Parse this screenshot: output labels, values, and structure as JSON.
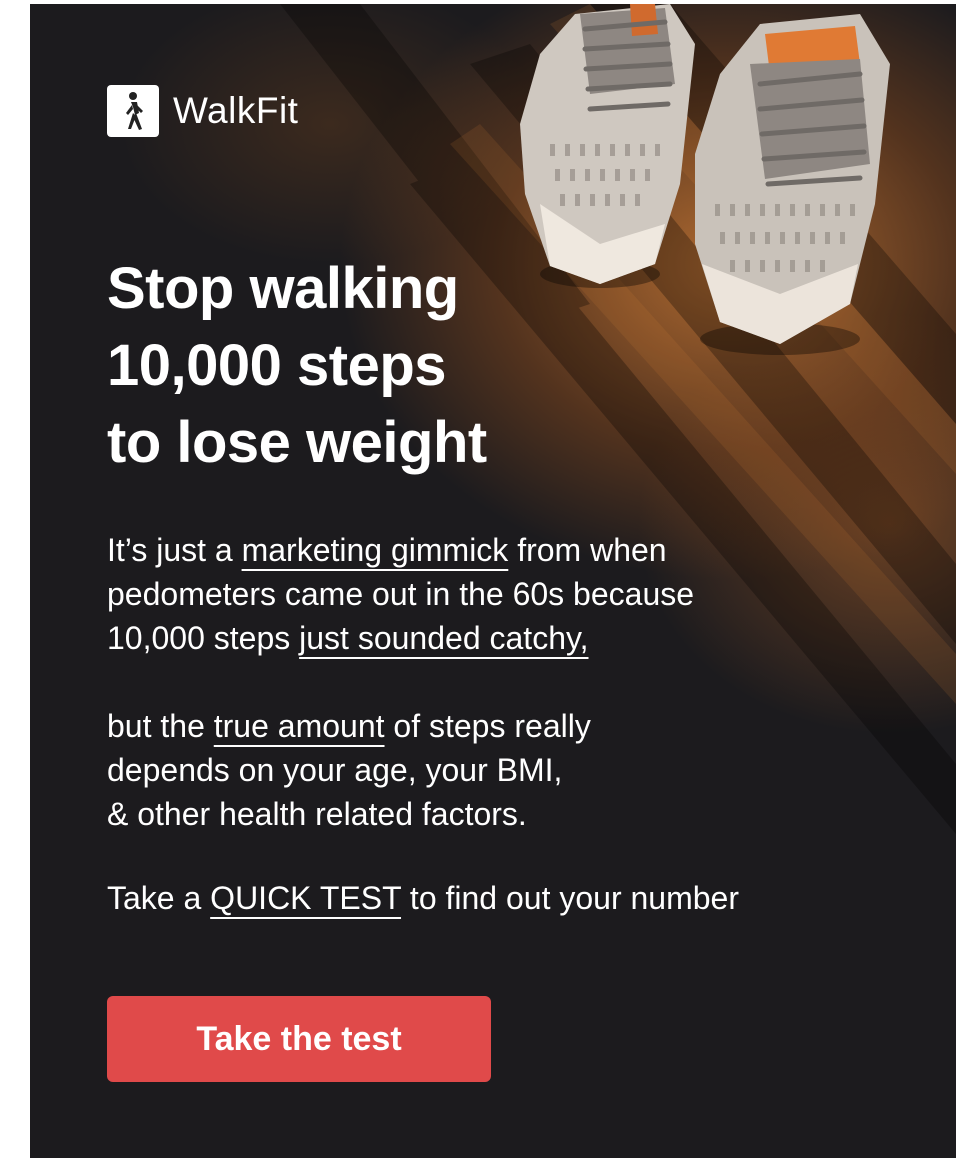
{
  "brand": {
    "name": "WalkFit",
    "logo_icon": "walking-person-icon"
  },
  "hero_image": {
    "icon": "running-shoes-image"
  },
  "headline": {
    "line1": "Stop walking",
    "line2": "10,000 steps",
    "line3": "to lose weight"
  },
  "paragraph1": {
    "line1_before": "It’s just a ",
    "line1_link": "marketing gimmick",
    "line1_after": " from when",
    "line2": "pedometers came out in the 60s because",
    "line3_before": "10,000 steps ",
    "line3_link": "just sounded catchy,"
  },
  "paragraph2": {
    "line1_before": "but the ",
    "line1_link": "true amount",
    "line1_after": " of steps really",
    "line2": "depends on your age, your BMI,",
    "line3": "& other health related factors."
  },
  "paragraph3": {
    "before": "Take a ",
    "link": "QUICK TEST",
    "after": " to find out your number"
  },
  "cta": {
    "label": "Take the test"
  },
  "colors": {
    "background": "#1c1b1e",
    "accent": "#e04a4a",
    "text": "#ffffff"
  }
}
